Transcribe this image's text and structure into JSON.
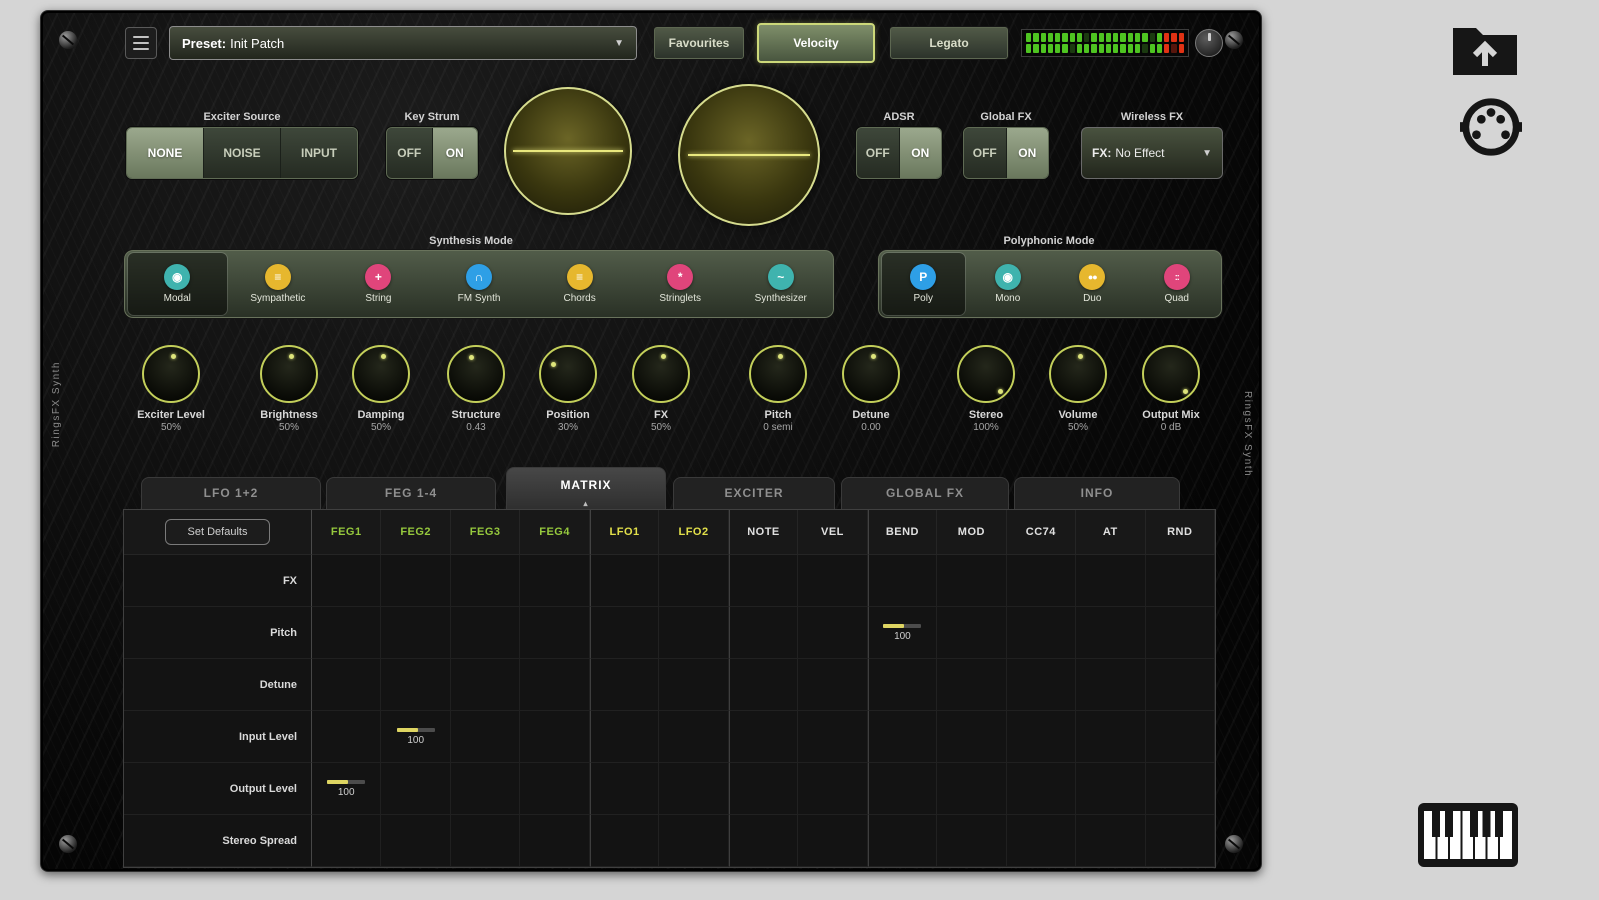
{
  "branding": {
    "left_vertical": "RingsFX Synth",
    "right_vertical": "RingsFX Synth"
  },
  "icons": {
    "dropdown_arrow": "▼",
    "tab_arrow": "▴"
  },
  "topbar": {
    "preset": {
      "prefix": "Preset:",
      "name": "Init Patch"
    },
    "favourites_label": "Favourites",
    "velocity_label": "Velocity",
    "legato_label": "Legato",
    "meter_rows": [
      "GGGGGGGGDGGGGGGGGDGRRR",
      "GGGGGGDGGGGGGGGGDGGRrR"
    ]
  },
  "controls": {
    "exciter_source": {
      "label": "Exciter Source",
      "options": [
        "NONE",
        "NOISE",
        "INPUT"
      ],
      "selected": "NONE"
    },
    "key_strum": {
      "label": "Key Strum",
      "options": [
        "OFF",
        "ON"
      ],
      "selected": "ON"
    },
    "adsr": {
      "label": "ADSR",
      "options": [
        "OFF",
        "ON"
      ],
      "selected": "ON"
    },
    "global_fx": {
      "label": "Global FX",
      "options": [
        "OFF",
        "ON"
      ],
      "selected": "ON"
    },
    "wireless_fx": {
      "label": "Wireless FX",
      "prefix": "FX:",
      "value": "No Effect"
    }
  },
  "synthesis_mode": {
    "label": "Synthesis Mode",
    "items": [
      {
        "label": "Modal",
        "color": "#3fb3ae",
        "glyph": "◉",
        "selected": true
      },
      {
        "label": "Sympathetic",
        "color": "#e6b72e",
        "glyph": "≡",
        "selected": false
      },
      {
        "label": "String",
        "color": "#e0457b",
        "glyph": "+",
        "selected": false
      },
      {
        "label": "FM Synth",
        "color": "#2e9fe6",
        "glyph": "∩",
        "selected": false
      },
      {
        "label": "Chords",
        "color": "#e6b72e",
        "glyph": "≡",
        "selected": false
      },
      {
        "label": "Stringlets",
        "color": "#e0457b",
        "glyph": "*",
        "selected": false
      },
      {
        "label": "Synthesizer",
        "color": "#3fb3ae",
        "glyph": "~",
        "selected": false
      }
    ]
  },
  "polyphonic_mode": {
    "label": "Polyphonic Mode",
    "items": [
      {
        "label": "Poly",
        "color": "#2e9fe6",
        "glyph": "P",
        "selected": true
      },
      {
        "label": "Mono",
        "color": "#3fb3ae",
        "glyph": "◉",
        "selected": false
      },
      {
        "label": "Duo",
        "color": "#e6b72e",
        "glyph": "●●",
        "selected": false
      },
      {
        "label": "Quad",
        "color": "#e0457b",
        "glyph": "::",
        "selected": false
      }
    ]
  },
  "knobs": [
    {
      "label": "Exciter Level",
      "value": "50%",
      "angle": 0
    },
    {
      "label": "Brightness",
      "value": "50%",
      "angle": 0
    },
    {
      "label": "Damping",
      "value": "50%",
      "angle": 0
    },
    {
      "label": "Structure",
      "value": "0.43",
      "angle": -20
    },
    {
      "label": "Position",
      "value": "30%",
      "angle": -55
    },
    {
      "label": "FX",
      "value": "50%",
      "angle": 0
    },
    {
      "label": "Pitch",
      "value": "0 semi",
      "angle": 0
    },
    {
      "label": "Detune",
      "value": "0.00",
      "angle": 0
    },
    {
      "label": "Stereo",
      "value": "100%",
      "angle": 140
    },
    {
      "label": "Volume",
      "value": "50%",
      "angle": 0
    },
    {
      "label": "Output Mix",
      "value": "0 dB",
      "angle": 140
    }
  ],
  "tabs": [
    {
      "label": "LFO 1+2",
      "active": false
    },
    {
      "label": "FEG 1-4",
      "active": false
    },
    {
      "label": "MATRIX",
      "active": true
    },
    {
      "label": "EXCITER",
      "active": false
    },
    {
      "label": "GLOBAL FX",
      "active": false
    },
    {
      "label": "INFO",
      "active": false
    }
  ],
  "matrix": {
    "set_defaults_label": "Set Defaults",
    "columns": [
      {
        "label": "FEG1",
        "color": "#96c93d"
      },
      {
        "label": "FEG2",
        "color": "#96c93d"
      },
      {
        "label": "FEG3",
        "color": "#96c93d"
      },
      {
        "label": "FEG4",
        "color": "#96c93d"
      },
      {
        "label": "LFO1",
        "color": "#e2e04a"
      },
      {
        "label": "LFO2",
        "color": "#e2e04a"
      },
      {
        "label": "NOTE",
        "color": "#e0e0e0"
      },
      {
        "label": "VEL",
        "color": "#e0e0e0"
      },
      {
        "label": "BEND",
        "color": "#e0e0e0"
      },
      {
        "label": "MOD",
        "color": "#e0e0e0"
      },
      {
        "label": "CC74",
        "color": "#e0e0e0"
      },
      {
        "label": "AT",
        "color": "#e0e0e0"
      },
      {
        "label": "RND",
        "color": "#e0e0e0"
      }
    ],
    "rows": [
      {
        "label": "FX",
        "cells": {}
      },
      {
        "label": "Pitch",
        "cells": {
          "BEND": "100"
        }
      },
      {
        "label": "Detune",
        "cells": {}
      },
      {
        "label": "Input Level",
        "cells": {
          "FEG2": "100"
        }
      },
      {
        "label": "Output Level",
        "cells": {
          "FEG1": "100"
        }
      },
      {
        "label": "Stereo Spread",
        "cells": {}
      }
    ]
  },
  "colors": {
    "accent": "#cdd95e",
    "panel_bg": "#0b0b0b",
    "led_green": "#4ec421",
    "led_red": "#e03214"
  }
}
